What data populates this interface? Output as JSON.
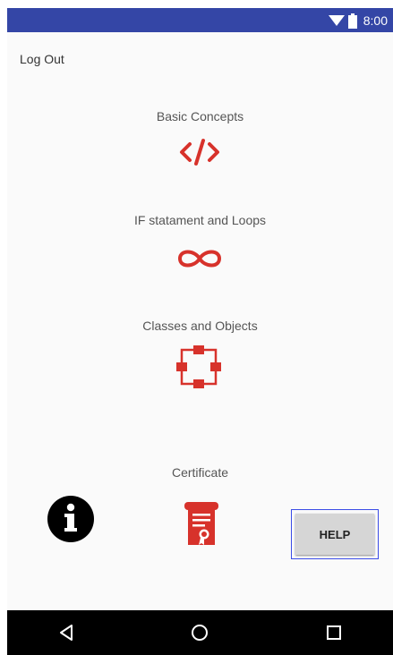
{
  "status_bar": {
    "time": "8:00",
    "icons": [
      "wifi-icon",
      "battery-icon"
    ],
    "background": "#3446a6"
  },
  "header": {
    "logout_label": "Log Out"
  },
  "menu": {
    "items": [
      {
        "label": "Basic Concepts",
        "icon": "code-icon"
      },
      {
        "label": "IF statament and Loops",
        "icon": "infinity-icon"
      },
      {
        "label": "Classes and Objects",
        "icon": "class-diagram-icon"
      },
      {
        "label": "Certificate",
        "icon": "certificate-icon"
      }
    ],
    "icon_color": "#d7322b"
  },
  "bottom_actions": {
    "info_icon": "info-icon",
    "help_label": "HELP"
  },
  "nav_bar": {
    "buttons": [
      "back-icon",
      "home-icon",
      "recents-icon"
    ]
  }
}
